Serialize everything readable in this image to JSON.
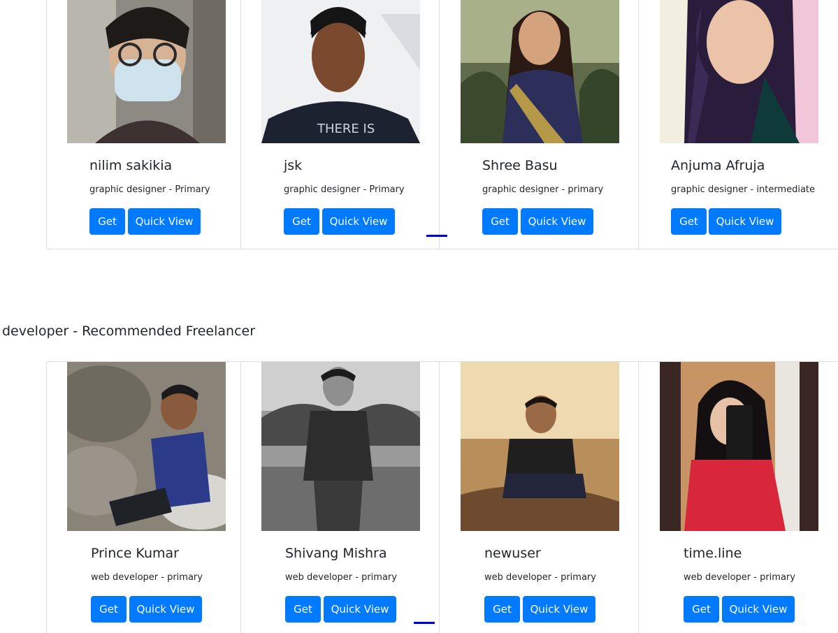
{
  "sections": [
    {
      "heading": "",
      "cards": [
        {
          "name": "nilim sakikia",
          "role": "graphic designer - Primary",
          "get_label": "Get",
          "quick_view_label": "Quick View"
        },
        {
          "name": "jsk",
          "role": "graphic designer - Primary",
          "get_label": "Get",
          "quick_view_label": "Quick View"
        },
        {
          "name": "Shree Basu",
          "role": "graphic designer - primary",
          "get_label": "Get",
          "quick_view_label": "Quick View"
        },
        {
          "name": "Anjuma Afruja",
          "role": "graphic designer - intermediate",
          "get_label": "Get",
          "quick_view_label": "Quick View"
        }
      ]
    },
    {
      "heading": "developer - Recommended Freelancer",
      "cards": [
        {
          "name": "Prince Kumar",
          "role": "web developer - primary",
          "get_label": "Get",
          "quick_view_label": "Quick View"
        },
        {
          "name": "Shivang Mishra",
          "role": "web developer - primary",
          "get_label": "Get",
          "quick_view_label": "Quick View"
        },
        {
          "name": "newuser",
          "role": "web developer - primary",
          "get_label": "Get",
          "quick_view_label": "Quick View"
        },
        {
          "name": "time.line",
          "role": "web developer - primary",
          "get_label": "Get",
          "quick_view_label": "Quick View"
        }
      ]
    }
  ],
  "colors": {
    "primary_button": "#007bff",
    "carousel_indicator": "#0000cc",
    "border": "#dddddd",
    "text": "#212529"
  }
}
